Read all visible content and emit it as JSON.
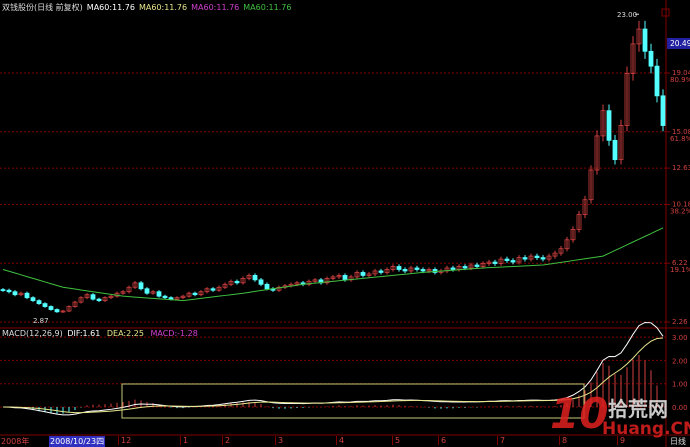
{
  "header": {
    "stock": "双钱股份(日线 前复权)",
    "ma": [
      {
        "label": "MA60:11.76",
        "color": "#ffffff"
      },
      {
        "label": "MA60:11.76",
        "color": "#e6e68c"
      },
      {
        "label": "MA60:11.76",
        "color": "#d040d0"
      },
      {
        "label": "MA60:11.76",
        "color": "#40c040"
      }
    ]
  },
  "macd_header": {
    "name": "MACD(12,26,9)",
    "dif": "DIF:1.61",
    "dea": "DEA:2.25",
    "macd": "MACD:-1.28"
  },
  "price_axis": [
    {
      "value": 19.04,
      "label": "19.04",
      "pct": "80.9%"
    },
    {
      "value": 15.08,
      "label": "15.08",
      "pct": "61.8%"
    },
    {
      "value": 12.63,
      "label": "12.63",
      "pct": ""
    },
    {
      "value": 10.18,
      "label": "10.18",
      "pct": "38.2%"
    },
    {
      "value": 6.22,
      "label": "6.22",
      "pct": "19.1%"
    },
    {
      "value": 2.26,
      "label": "2.26",
      "pct": ""
    }
  ],
  "current_price": "20.49",
  "high_label": "23.00",
  "low_label": "2.87",
  "macd_axis": [
    "3.00",
    "2.00",
    "1.00",
    "0.00"
  ],
  "time_axis": {
    "year": "2008年",
    "cursor_date": "2008/10/23四",
    "months": [
      "12",
      "1",
      "2",
      "3",
      "4",
      "5",
      "6",
      "7",
      "8",
      "9"
    ],
    "period": "日线"
  },
  "watermark": {
    "number": "10",
    "cn": "拾荒网",
    "en": "Huang.CN"
  },
  "colors": {
    "up": "#d04040",
    "down": "#54ffff",
    "ma60": "#40c040",
    "dif": "#ffffff",
    "dea": "#e6e68c",
    "grid": "#800000",
    "box": "#c8c878"
  },
  "chart_data": {
    "type": "candlestick",
    "closes": [
      4.4,
      4.3,
      4.1,
      4.2,
      3.9,
      3.7,
      3.5,
      3.3,
      3.1,
      2.95,
      3.0,
      3.3,
      3.6,
      3.9,
      4.1,
      3.8,
      3.7,
      3.9,
      4.0,
      4.2,
      4.3,
      4.6,
      4.9,
      4.5,
      4.2,
      4.3,
      4.0,
      3.9,
      3.8,
      3.9,
      4.0,
      4.2,
      4.1,
      4.3,
      4.5,
      4.4,
      4.6,
      4.8,
      5.0,
      4.9,
      5.2,
      5.4,
      5.1,
      4.8,
      4.5,
      4.4,
      4.6,
      4.7,
      4.8,
      4.9,
      4.8,
      5.0,
      5.1,
      4.9,
      5.2,
      5.3,
      5.4,
      5.1,
      5.3,
      5.6,
      5.4,
      5.5,
      5.7,
      5.6,
      5.8,
      6.0,
      5.8,
      5.7,
      5.9,
      5.8,
      5.7,
      5.8,
      5.6,
      5.7,
      5.9,
      5.8,
      6.0,
      5.9,
      6.1,
      6.0,
      6.2,
      6.3,
      6.2,
      6.5,
      6.4,
      6.3,
      6.6,
      6.5,
      6.7,
      6.6,
      6.5,
      6.7,
      6.9,
      7.2,
      7.8,
      8.5,
      9.5,
      10.5,
      12.5,
      14.8,
      16.5,
      14.5,
      13.2,
      15.5,
      19.0,
      21.0,
      22.0,
      20.5,
      19.5,
      17.5,
      15.5
    ],
    "ma60_keypoints": [
      5.8,
      4.6,
      4.0,
      3.7,
      4.2,
      4.8,
      5.2,
      5.6,
      5.9,
      6.1,
      6.7,
      8.6,
      11.8
    ],
    "price_range": [
      2.26,
      23.0
    ],
    "macd_range": [
      -0.4,
      3.2
    ]
  }
}
